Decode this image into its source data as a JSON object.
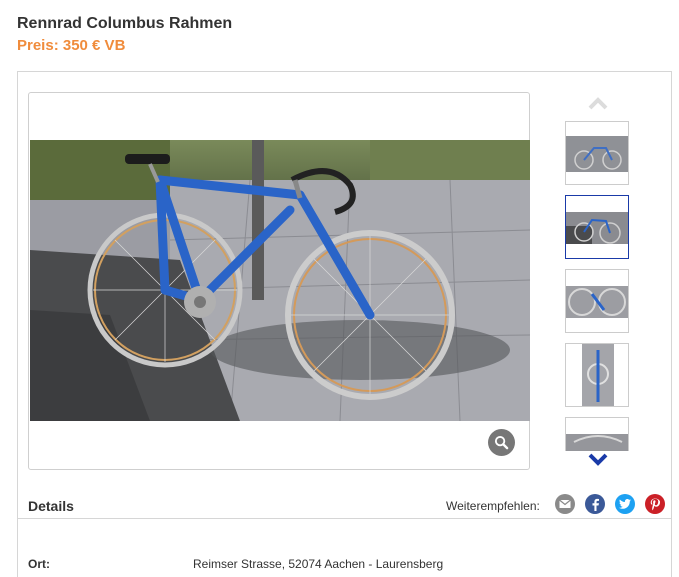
{
  "listing": {
    "title": "Rennrad Columbus Rahmen",
    "price": "Preis: 350 € VB"
  },
  "gallery": {
    "main_image": "blue-road-bike-photo",
    "zoom_icon": "magnifier-icon",
    "thumbnails": [
      {
        "image": "bike-thumb-1",
        "active": false
      },
      {
        "image": "bike-thumb-2",
        "active": true
      },
      {
        "image": "bike-thumb-3",
        "active": false
      },
      {
        "image": "bike-thumb-4",
        "active": false
      },
      {
        "image": "bike-thumb-5",
        "active": false
      }
    ],
    "scroll_up_icon": "chevron-up-icon",
    "scroll_down_icon": "chevron-down-icon"
  },
  "details": {
    "heading": "Details",
    "share_label": "Weiterempfehlen:",
    "share_icons": [
      "email-icon",
      "facebook-icon",
      "twitter-icon",
      "pinterest-icon"
    ]
  },
  "fields": {
    "ort_label": "Ort:",
    "ort_value": "Reimser Strasse, 52074 Aachen - Laurensberg"
  },
  "colors": {
    "price": "#f08c3c",
    "active_thumb_border": "#1a3aa8",
    "email": "#8a8a8a",
    "facebook": "#3b5998",
    "twitter": "#1da1f2",
    "pinterest": "#cb2027"
  }
}
